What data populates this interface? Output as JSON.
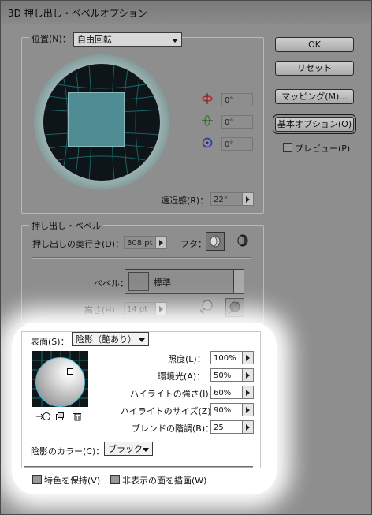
{
  "window": {
    "title": "3D 押し出し・ベベルオプション"
  },
  "buttons": {
    "ok": "OK",
    "reset": "リセット",
    "mapping": "マッピング(M)...",
    "basic_options": "基本オプション(O)"
  },
  "preview": {
    "label": "プレビュー(P)",
    "checked": false
  },
  "position": {
    "label": "位置(N)：",
    "selected": "自由回転",
    "rot_x": "0°",
    "rot_y": "0°",
    "rot_z": "0°",
    "perspective_label": "遠近感(R)：",
    "perspective_value": "22°"
  },
  "extrude": {
    "legend": "押し出し・ベベル",
    "depth_label": "押し出しの奥行き(D)：",
    "depth_value": "308 pt",
    "cap_label": "フタ：",
    "bevel_label": "ベベル：",
    "bevel_value": "標準",
    "height_label": "高さ(H)：",
    "height_value": "14 pt"
  },
  "surface": {
    "label": "表面(S)：",
    "selected": "陰影（艶あり）",
    "intensity_label": "照度(L)：",
    "intensity_value": "100%",
    "ambient_label": "環境光(A)：",
    "ambient_value": "50%",
    "highlight_intensity_label": "ハイライトの強さ(I)：",
    "highlight_intensity_value": "60%",
    "highlight_size_label": "ハイライトのサイズ(Z)：",
    "highlight_size_value": "90%",
    "blend_steps_label": "ブレンドの階調(B)：",
    "blend_steps_value": "25",
    "shading_color_label": "陰影のカラー(C)：",
    "shading_color_value": "ブラック"
  },
  "options": {
    "preserve_spot": "特色を保持(V)",
    "draw_hidden": "非表示の面を描画(W)"
  }
}
